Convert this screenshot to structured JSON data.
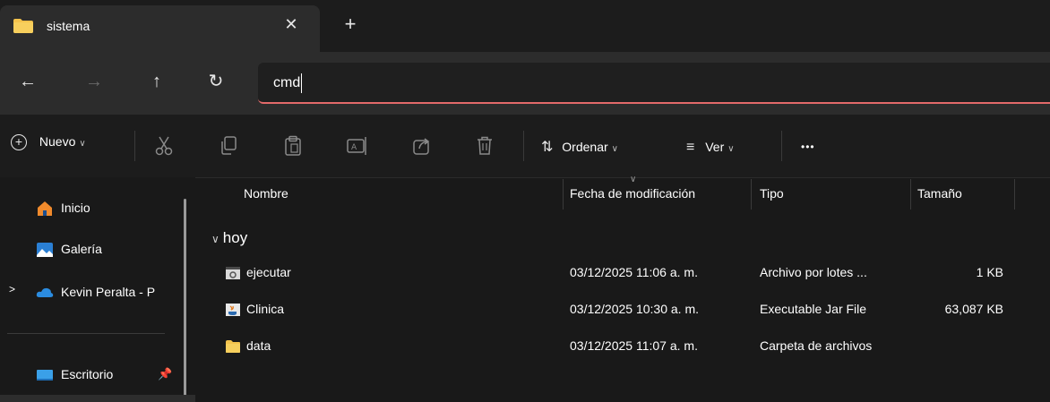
{
  "tab": {
    "title": "sistema",
    "close_glyph": "✕",
    "new_glyph": "+"
  },
  "nav": {
    "back": "←",
    "forward": "→",
    "up": "↑",
    "refresh": "↻"
  },
  "address": {
    "value": "cmd"
  },
  "toolbar": {
    "new_label": "Nuevo",
    "sort_label": "Ordenar",
    "view_label": "Ver",
    "more_label": "•••",
    "icons": [
      "cut-icon",
      "copy-icon",
      "paste-icon",
      "rename-icon",
      "share-icon",
      "delete-icon"
    ]
  },
  "sidebar": {
    "items": [
      {
        "label": "Inicio",
        "icon": "home-icon"
      },
      {
        "label": "Galería",
        "icon": "gallery-icon"
      },
      {
        "label": "Kevin Peralta - P",
        "icon": "onedrive-icon"
      },
      {
        "label": "Escritorio",
        "icon": "desktop-icon"
      }
    ]
  },
  "columns": {
    "name": "Nombre",
    "date": "Fecha de modificación",
    "type": "Tipo",
    "size": "Tamaño"
  },
  "group": {
    "label": "hoy"
  },
  "files": [
    {
      "name": "ejecutar",
      "date": "03/12/2025 11:06 a. m.",
      "type": "Archivo por lotes ...",
      "size": "1 KB",
      "icon": "batch-file-icon"
    },
    {
      "name": "Clinica",
      "date": "03/12/2025 10:30 a. m.",
      "type": "Executable Jar File",
      "size": "63,087 KB",
      "icon": "java-jar-icon"
    },
    {
      "name": "data",
      "date": "03/12/2025 11:07 a. m.",
      "type": "Carpeta de archivos",
      "size": "",
      "icon": "folder-icon"
    }
  ],
  "colors": {
    "accent_underline": "#e36a6a",
    "folder": "#f4c34c",
    "background": "#191919"
  }
}
